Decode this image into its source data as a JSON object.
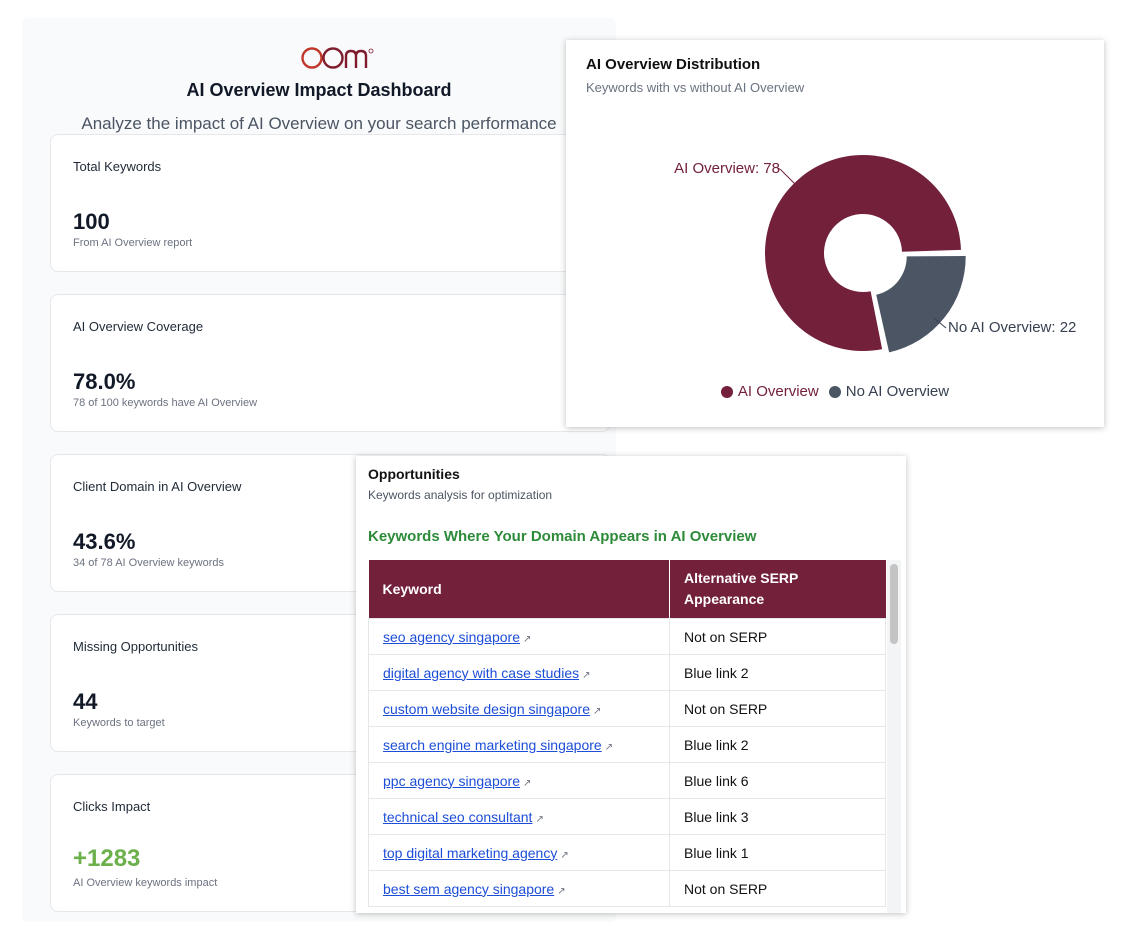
{
  "dashboard": {
    "logo_text": "OOm",
    "title": "AI Overview Impact Dashboard",
    "subtitle": "Analyze the impact of AI Overview on your search performance",
    "cards": [
      {
        "title": "Total Keywords",
        "value": "100",
        "note": "From AI Overview report"
      },
      {
        "title": "AI Overview Coverage",
        "value": "78.0%",
        "note": "78 of 100 keywords have AI Overview"
      },
      {
        "title": "Client Domain in AI Overview",
        "value": "43.6%",
        "note": "34 of 78 AI Overview keywords"
      },
      {
        "title": "Missing Opportunities",
        "value": "44",
        "note": "Keywords to target"
      },
      {
        "title": "Clicks Impact",
        "value": "+1283",
        "note": "AI Overview keywords impact"
      }
    ]
  },
  "distribution": {
    "title": "AI Overview Distribution",
    "subtitle": "Keywords with vs without AI Overview",
    "label_ai": "AI Overview: 78",
    "label_no_ai": "No AI Overview: 22",
    "legend": [
      "AI Overview",
      "No AI Overview"
    ],
    "colors": {
      "ai": "#73203b",
      "no_ai": "#4b5563"
    }
  },
  "chart_data": {
    "type": "pie",
    "categories": [
      "AI Overview",
      "No AI Overview"
    ],
    "values": [
      78,
      22
    ],
    "title": "AI Overview Distribution",
    "subtitle": "Keywords with vs without AI Overview"
  },
  "opportunities": {
    "title": "Opportunities",
    "subtitle": "Keywords analysis for optimization",
    "heading": "Keywords Where Your Domain Appears in AI Overview",
    "columns": [
      "Keyword",
      "Alternative SERP Appearance"
    ],
    "rows": [
      {
        "keyword": "seo agency singapore",
        "appearance": "Not on SERP"
      },
      {
        "keyword": "digital agency with case studies",
        "appearance": "Blue link 2"
      },
      {
        "keyword": "custom website design singapore",
        "appearance": "Not on SERP"
      },
      {
        "keyword": "search engine marketing singapore",
        "appearance": "Blue link 2"
      },
      {
        "keyword": "ppc agency singapore",
        "appearance": "Blue link 6"
      },
      {
        "keyword": "technical seo consultant",
        "appearance": "Blue link 3"
      },
      {
        "keyword": "top digital marketing agency",
        "appearance": "Blue link 1"
      },
      {
        "keyword": "best sem agency singapore",
        "appearance": "Not on SERP"
      }
    ]
  }
}
